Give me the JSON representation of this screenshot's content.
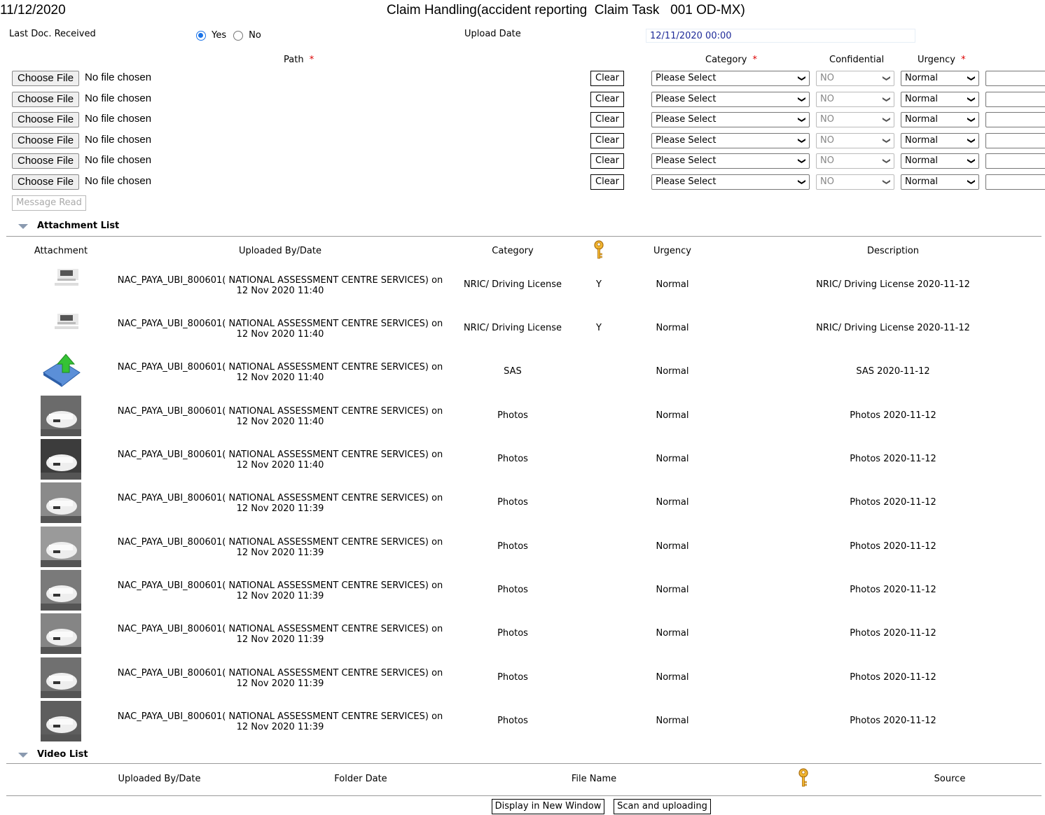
{
  "header": {
    "date": "11/12/2020",
    "title": "Claim Handling(accident reporting  Claim Task   001 OD-MX)"
  },
  "form": {
    "last_doc_label": "Last Doc. Received",
    "yes_label": "Yes",
    "no_label": "No",
    "last_doc_selected": "Yes",
    "upload_date_label": "Upload Date",
    "upload_date_value": "12/11/2020 00:00",
    "path_label": "Path",
    "category_label": "Category",
    "confidential_label": "Confidential",
    "urgency_label": "Urgency",
    "required_mark": "*",
    "choose_file_label": "Choose File",
    "no_file_text": "No file chosen",
    "clear_label": "Clear",
    "category_value": "Please Select",
    "confidential_value": "NO",
    "urgency_value": "Normal",
    "message_read_label": "Message Read"
  },
  "attachment_list": {
    "title": "Attachment List",
    "headers": {
      "attachment": "Attachment",
      "uploaded_by": "Uploaded By/Date",
      "category": "Category",
      "key_icon": "key-icon",
      "urgency": "Urgency",
      "description": "Description"
    },
    "rows": [
      {
        "thumb": "document-scan",
        "by": "NAC_PAYA_UBI_800601( NATIONAL ASSESSMENT CENTRE SERVICES) on",
        "date": "12 Nov 2020 11:40",
        "category": "NRIC/ Driving License",
        "confidential": "Y",
        "urgency": "Normal",
        "description": "NRIC/ Driving License 2020-11-12"
      },
      {
        "thumb": "document-scan",
        "by": "NAC_PAYA_UBI_800601( NATIONAL ASSESSMENT CENTRE SERVICES) on",
        "date": "12 Nov 2020 11:40",
        "category": "NRIC/ Driving License",
        "confidential": "Y",
        "urgency": "Normal",
        "description": "NRIC/ Driving License 2020-11-12"
      },
      {
        "thumb": "upload-file-icon",
        "by": "NAC_PAYA_UBI_800601( NATIONAL ASSESSMENT CENTRE SERVICES) on",
        "date": "12 Nov 2020 11:40",
        "category": "SAS",
        "confidential": "",
        "urgency": "Normal",
        "description": "SAS 2020-11-12"
      },
      {
        "thumb": "photo",
        "by": "NAC_PAYA_UBI_800601( NATIONAL ASSESSMENT CENTRE SERVICES) on",
        "date": "12 Nov 2020 11:40",
        "category": "Photos",
        "confidential": "",
        "urgency": "Normal",
        "description": "Photos 2020-11-12"
      },
      {
        "thumb": "photo",
        "by": "NAC_PAYA_UBI_800601( NATIONAL ASSESSMENT CENTRE SERVICES) on",
        "date": "12 Nov 2020 11:40",
        "category": "Photos",
        "confidential": "",
        "urgency": "Normal",
        "description": "Photos 2020-11-12"
      },
      {
        "thumb": "photo",
        "by": "NAC_PAYA_UBI_800601( NATIONAL ASSESSMENT CENTRE SERVICES) on",
        "date": "12 Nov 2020 11:39",
        "category": "Photos",
        "confidential": "",
        "urgency": "Normal",
        "description": "Photos 2020-11-12"
      },
      {
        "thumb": "photo",
        "by": "NAC_PAYA_UBI_800601( NATIONAL ASSESSMENT CENTRE SERVICES) on",
        "date": "12 Nov 2020 11:39",
        "category": "Photos",
        "confidential": "",
        "urgency": "Normal",
        "description": "Photos 2020-11-12"
      },
      {
        "thumb": "photo",
        "by": "NAC_PAYA_UBI_800601( NATIONAL ASSESSMENT CENTRE SERVICES) on",
        "date": "12 Nov 2020 11:39",
        "category": "Photos",
        "confidential": "",
        "urgency": "Normal",
        "description": "Photos 2020-11-12"
      },
      {
        "thumb": "photo",
        "by": "NAC_PAYA_UBI_800601( NATIONAL ASSESSMENT CENTRE SERVICES) on",
        "date": "12 Nov 2020 11:39",
        "category": "Photos",
        "confidential": "",
        "urgency": "Normal",
        "description": "Photos 2020-11-12"
      },
      {
        "thumb": "photo",
        "by": "NAC_PAYA_UBI_800601( NATIONAL ASSESSMENT CENTRE SERVICES) on",
        "date": "12 Nov 2020 11:39",
        "category": "Photos",
        "confidential": "",
        "urgency": "Normal",
        "description": "Photos 2020-11-12"
      },
      {
        "thumb": "photo",
        "by": "NAC_PAYA_UBI_800601( NATIONAL ASSESSMENT CENTRE SERVICES) on",
        "date": "12 Nov 2020 11:39",
        "category": "Photos",
        "confidential": "",
        "urgency": "Normal",
        "description": "Photos 2020-11-12"
      }
    ]
  },
  "video_list": {
    "title": "Video List",
    "headers": {
      "uploaded_by": "Uploaded By/Date",
      "folder_date": "Folder Date",
      "file_name": "File Name",
      "key_icon": "key-icon",
      "source": "Source"
    }
  },
  "buttons": {
    "display_new_window": "Display in New Window",
    "scan_upload": "Scan and uploading"
  },
  "colors": {
    "accent": "#1a73e8",
    "required": "#dd0000",
    "date_text": "#1f2b99",
    "key": "#e0a020"
  }
}
